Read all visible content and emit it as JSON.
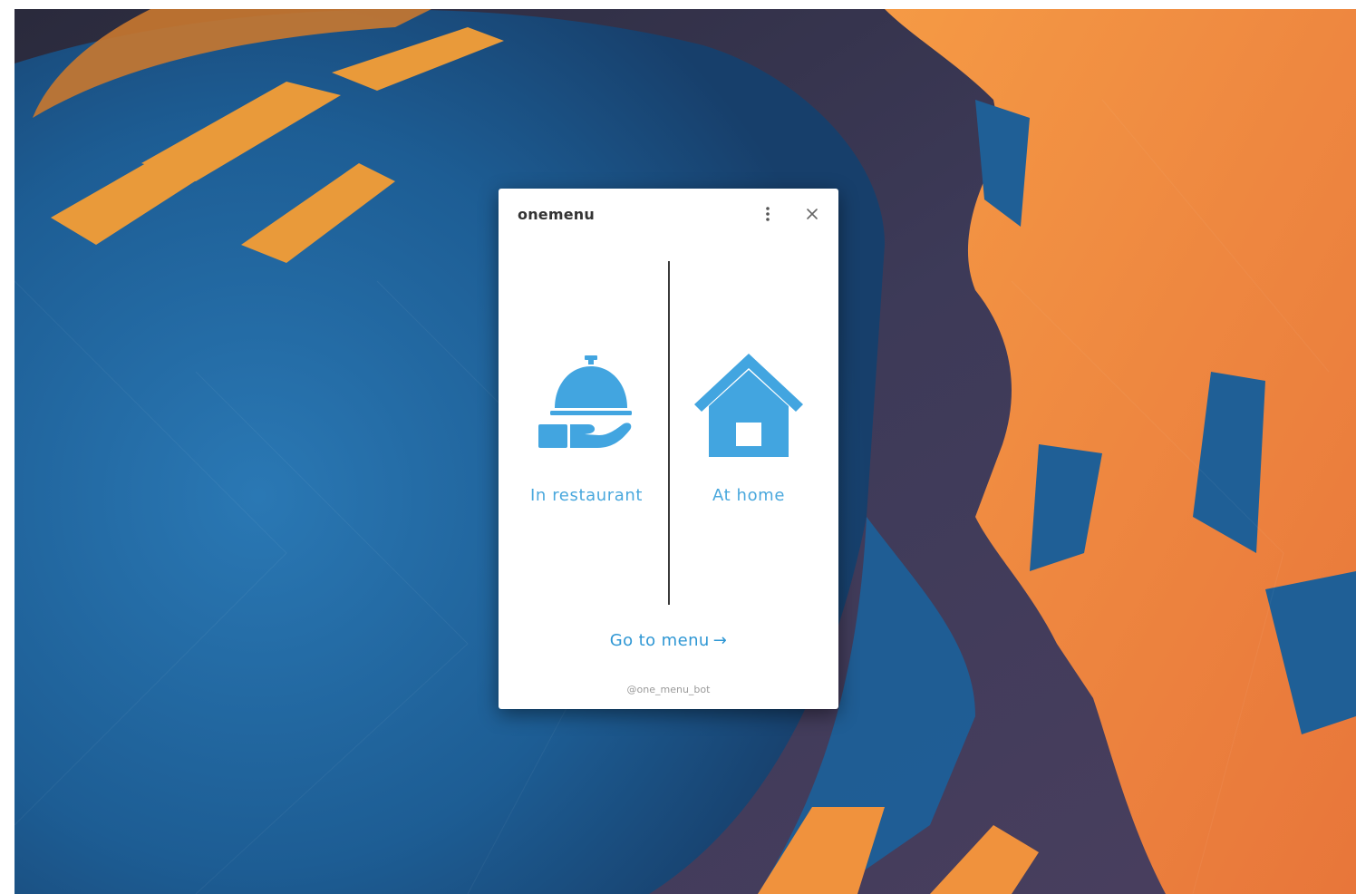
{
  "window": {
    "title": "onemenu",
    "menu_icon": "more-vertical-icon",
    "close_icon": "close-icon"
  },
  "options": [
    {
      "label": "In restaurant",
      "icon": "serving-cloche-hand-icon"
    },
    {
      "label": "At home",
      "icon": "house-icon"
    }
  ],
  "go_to_menu": {
    "label": "Go to menu",
    "arrow": "→"
  },
  "footer": {
    "handle": "@one_menu_bot"
  },
  "colors": {
    "accent": "#42a5e0",
    "link": "#2f97d4",
    "title": "#333333",
    "wallpaper_blue": "#1f5f96",
    "wallpaper_orange": "#ef8a3c",
    "wallpaper_dark": "#3a3550"
  }
}
